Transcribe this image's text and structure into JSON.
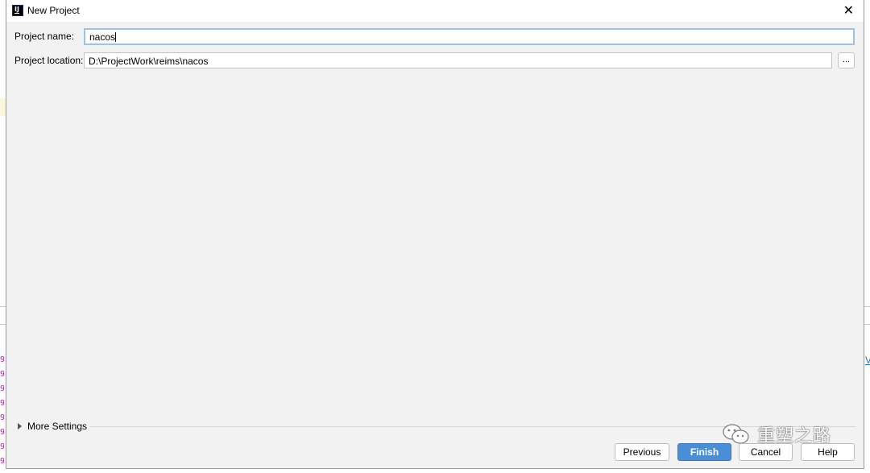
{
  "window": {
    "title": "New Project",
    "close_glyph": "✕"
  },
  "form": {
    "name_label": "Project name:",
    "name_value": "nacos",
    "location_label": "Project location:",
    "location_value": "D:\\ProjectWork\\reims\\nacos",
    "browse_label": "..."
  },
  "more_settings": {
    "label": "More Settings"
  },
  "buttons": {
    "previous": "Previous",
    "finish": "Finish",
    "cancel": "Cancel",
    "help": "Help"
  },
  "watermark": {
    "text": "重塑之路",
    "icon": "wechat-icon"
  },
  "background": {
    "right_link": "V",
    "left_marks": [
      "9",
      "9",
      "9",
      "9",
      "9",
      "9",
      "9",
      "9"
    ]
  },
  "colors": {
    "finish_button": "#4a8ed8",
    "focused_field_border": "#9cc2e8",
    "dialog_bg": "#f2f2f2"
  }
}
